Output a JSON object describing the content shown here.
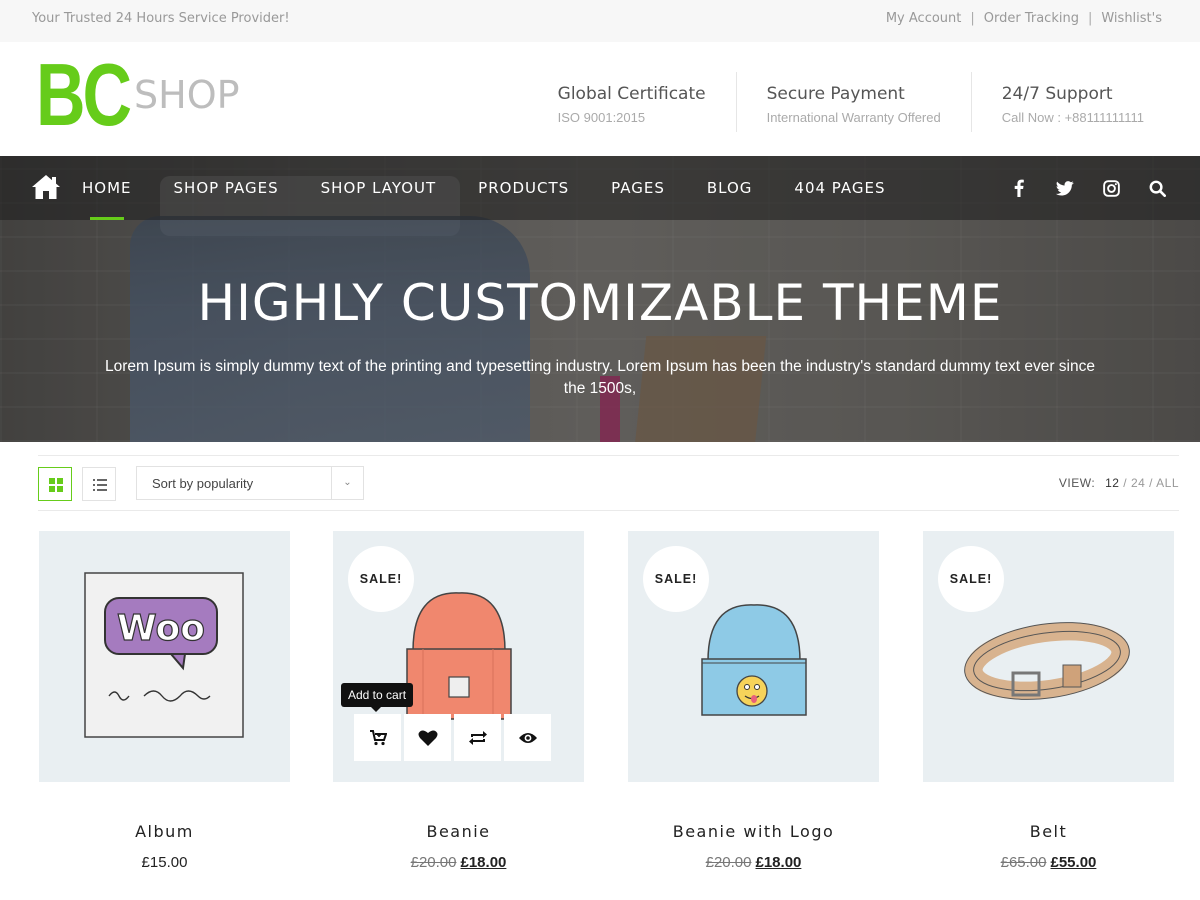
{
  "topbar": {
    "tagline": "Your Trusted 24 Hours Service Provider!",
    "links": [
      {
        "label": "My Account"
      },
      {
        "label": "Order Tracking"
      },
      {
        "label": "Wishlist's"
      }
    ],
    "separator": "|"
  },
  "header": {
    "logo": {
      "mark": "BC",
      "word": "SHOP"
    },
    "features": [
      {
        "title": "Global Certificate",
        "subtitle": "ISO 9001:2015"
      },
      {
        "title": "Secure Payment",
        "subtitle": "International Warranty Offered"
      },
      {
        "title": "24/7 Support",
        "subtitle": "Call Now : +88111111111"
      }
    ]
  },
  "nav": {
    "items": [
      {
        "label": "HOME",
        "active": true
      },
      {
        "label": "SHOP PAGES"
      },
      {
        "label": "SHOP LAYOUT"
      },
      {
        "label": "PRODUCTS"
      },
      {
        "label": "PAGES"
      },
      {
        "label": "BLOG"
      },
      {
        "label": "404 PAGES"
      }
    ],
    "social": [
      "facebook-icon",
      "twitter-icon",
      "instagram-icon",
      "search-icon"
    ]
  },
  "hero": {
    "title": "HIGHLY CUSTOMIZABLE THEME",
    "description": "Lorem Ipsum is simply dummy text of the printing and typesetting industry. Lorem Ipsum has been the industry's standard dummy text ever since the 1500s,"
  },
  "toolbar": {
    "sort_label": "Sort by popularity",
    "view_label": "VIEW:",
    "view_current": "12",
    "view_sep": " / ",
    "view_options": [
      "24",
      "ALL"
    ]
  },
  "products": [
    {
      "name": "Album",
      "price": "£15.00",
      "old_price": "",
      "sale": false
    },
    {
      "name": "Beanie",
      "price": "£18.00",
      "old_price": "£20.00",
      "sale": true,
      "sale_label": "SALE!"
    },
    {
      "name": "Beanie with Logo",
      "price": "£18.00",
      "old_price": "£20.00",
      "sale": true,
      "sale_label": "SALE!"
    },
    {
      "name": "Belt",
      "price": "£55.00",
      "old_price": "£65.00",
      "sale": true,
      "sale_label": "SALE!"
    }
  ],
  "hover": {
    "tooltip": "Add to cart",
    "actions": [
      "add-to-cart-icon",
      "heart-icon",
      "compare-icon",
      "quick-view-icon"
    ]
  },
  "colors": {
    "accent": "#66cc1a",
    "logo_word": "#bdbdbd",
    "product_bg": "#e9eff2"
  }
}
